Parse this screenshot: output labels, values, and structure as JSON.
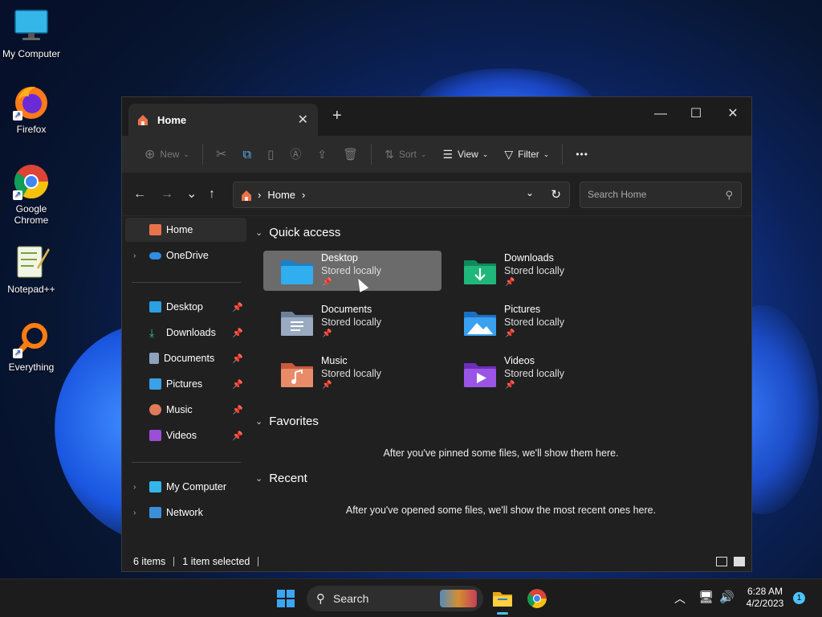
{
  "desktop": {
    "icons": [
      {
        "label": "My Computer"
      },
      {
        "label": "Firefox"
      },
      {
        "label": "Google Chrome"
      },
      {
        "label": "Notepad++"
      },
      {
        "label": "Everything"
      }
    ]
  },
  "window": {
    "tab_title": "Home",
    "tab_close": "✕",
    "new_tab": "+",
    "controls": {
      "minimize": "—",
      "maximize": "☐",
      "close": "✕"
    }
  },
  "toolbar": {
    "new_label": "New",
    "sort_label": "Sort",
    "view_label": "View",
    "filter_label": "Filter",
    "more_label": "•••"
  },
  "navigation": {
    "back": "←",
    "forward": "→",
    "recent": "⌄",
    "up": "↑",
    "breadcrumb": "Home",
    "search_placeholder": "Search Home"
  },
  "sidebar": {
    "items": [
      {
        "label": "Home"
      },
      {
        "label": "OneDrive"
      },
      {
        "label": "Desktop"
      },
      {
        "label": "Downloads"
      },
      {
        "label": "Documents"
      },
      {
        "label": "Pictures"
      },
      {
        "label": "Music"
      },
      {
        "label": "Videos"
      },
      {
        "label": "My Computer"
      },
      {
        "label": "Network"
      }
    ]
  },
  "content": {
    "quick_access_header": "Quick access",
    "favorites_header": "Favorites",
    "recent_header": "Recent",
    "quick_access": [
      {
        "name": "Desktop",
        "sub": "Stored locally"
      },
      {
        "name": "Downloads",
        "sub": "Stored locally"
      },
      {
        "name": "Documents",
        "sub": "Stored locally"
      },
      {
        "name": "Pictures",
        "sub": "Stored locally"
      },
      {
        "name": "Music",
        "sub": "Stored locally"
      },
      {
        "name": "Videos",
        "sub": "Stored locally"
      }
    ],
    "favorites_empty": "After you've pinned some files, we'll show them here.",
    "recent_empty": "After you've opened some files, we'll show the most recent ones here."
  },
  "status": {
    "items_count": "6 items",
    "selected": "1 item selected"
  },
  "taskbar": {
    "search_label": "Search",
    "time": "6:28 AM",
    "date": "4/2/2023",
    "notifications": "1"
  }
}
